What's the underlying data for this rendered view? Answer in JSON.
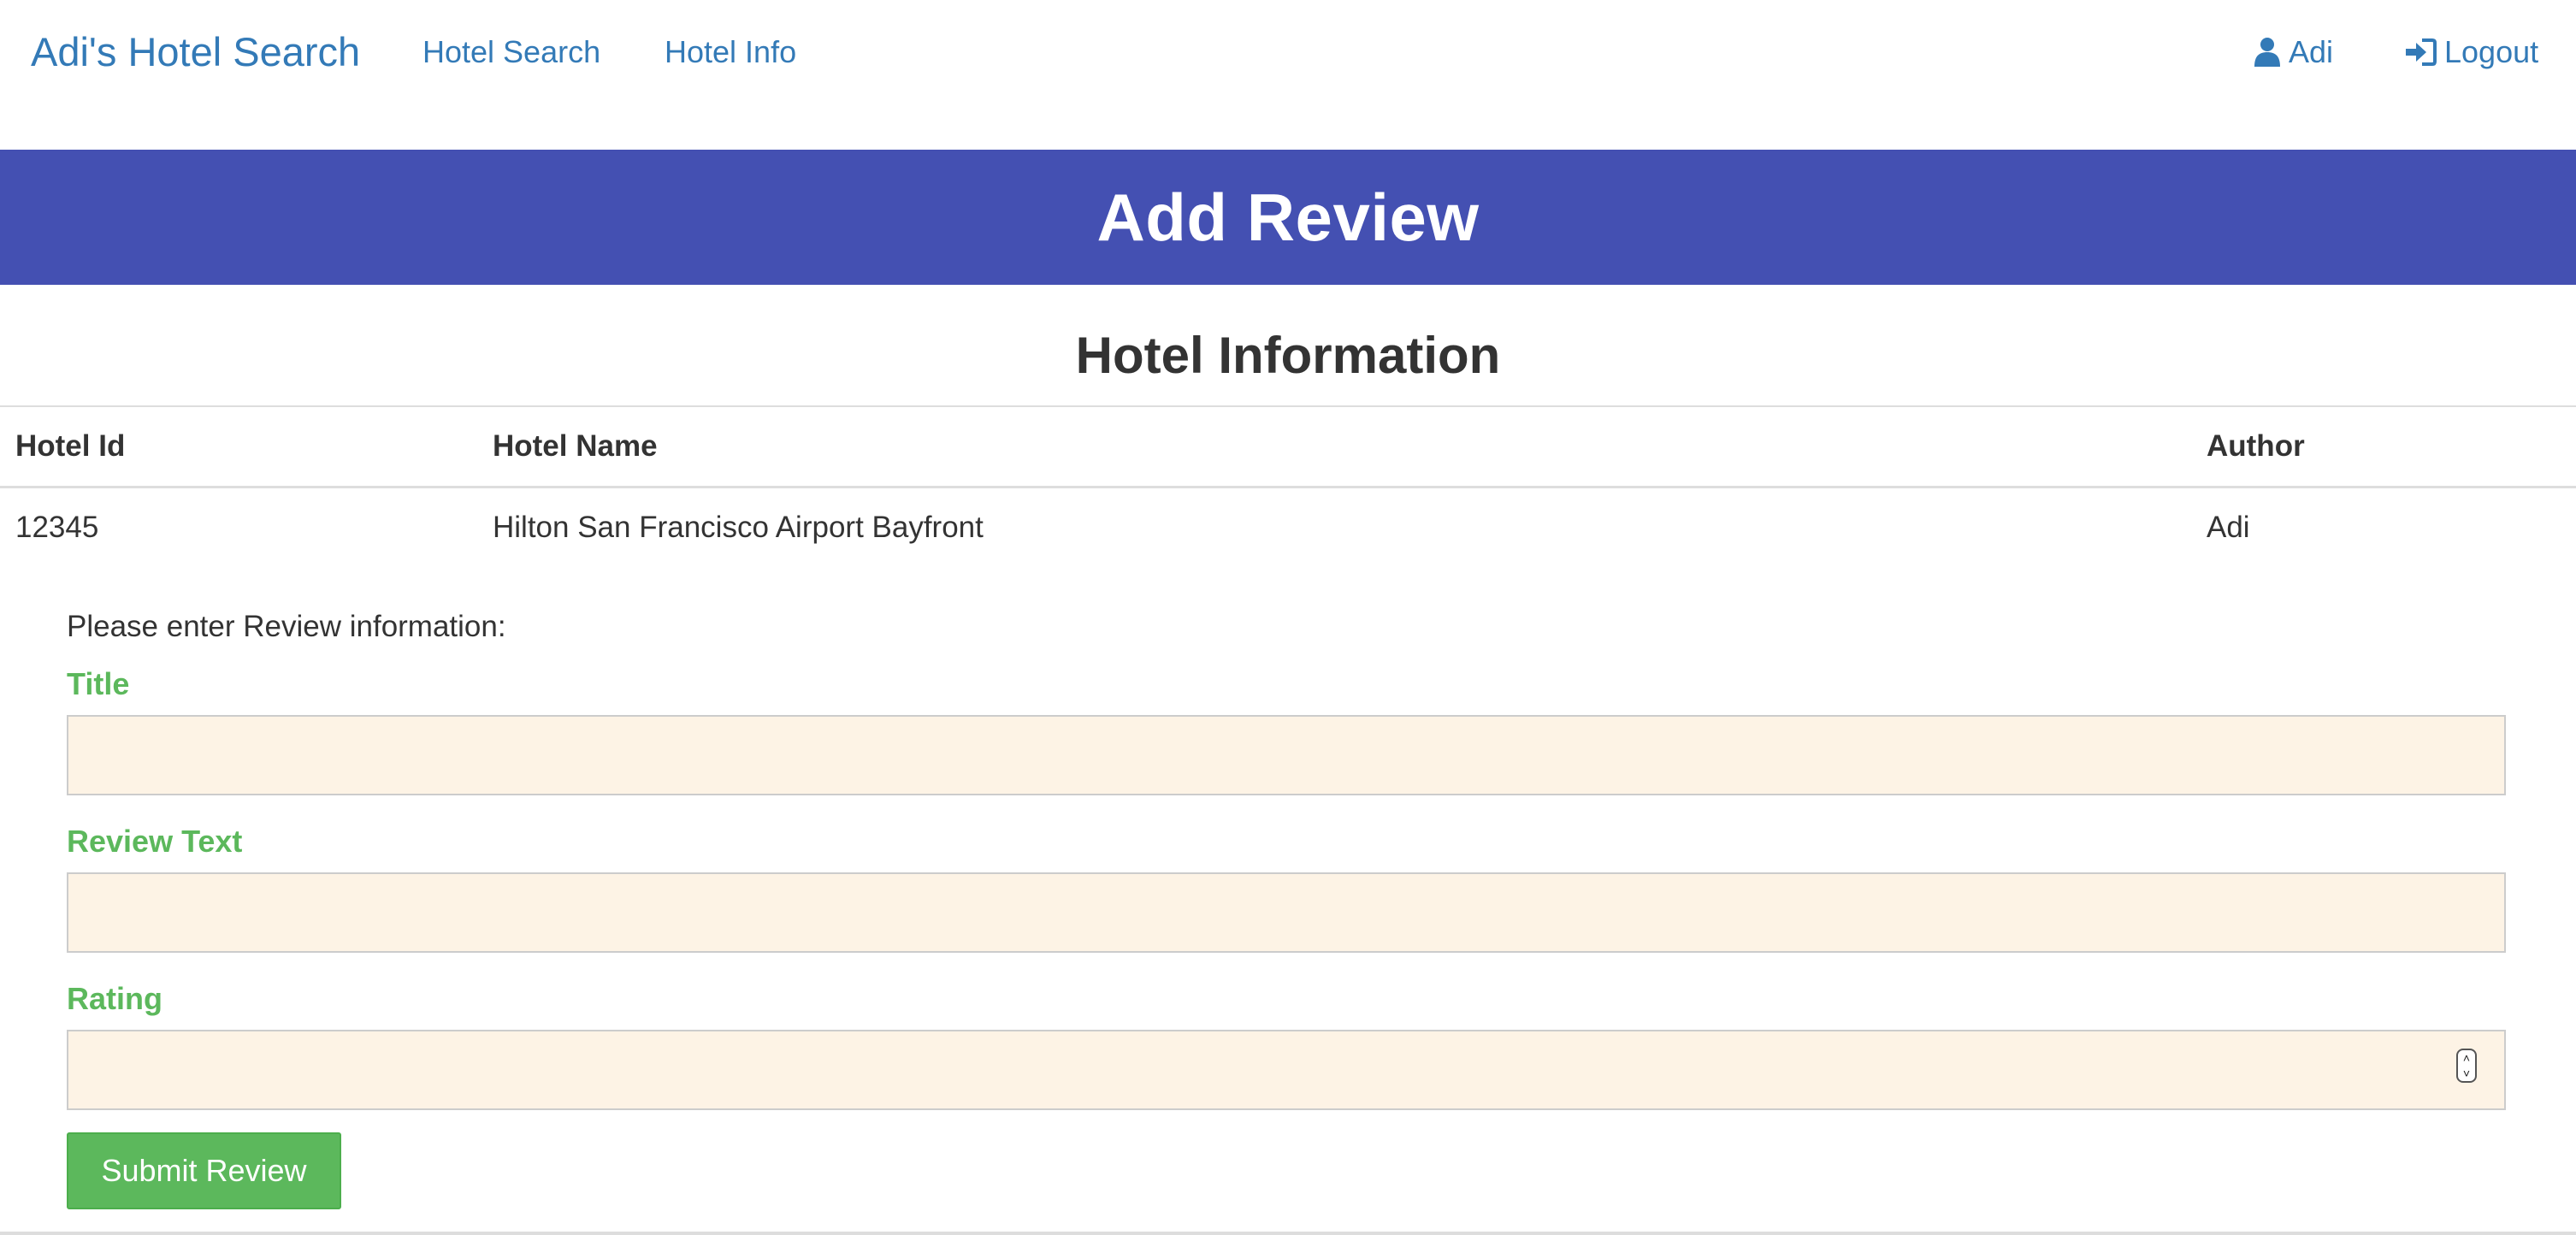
{
  "navbar": {
    "brand": "Adi's Hotel Search",
    "links": [
      {
        "label": "Hotel Search"
      },
      {
        "label": "Hotel Info"
      }
    ],
    "user_label": "Adi",
    "logout_label": "Logout",
    "link_color": "#337ab7"
  },
  "banner": {
    "title": "Add Review",
    "background": "#4450b2"
  },
  "hotel_info": {
    "title": "Hotel Information",
    "columns": [
      "Hotel Id",
      "Hotel Name",
      "Author"
    ],
    "rows": [
      [
        "12345",
        "Hilton San Francisco Airport Bayfront",
        "Adi"
      ]
    ]
  },
  "form": {
    "intro": "Please enter Review information:",
    "title_label": "Title",
    "title_value": "",
    "review_text_label": "Review Text",
    "review_text_value": "",
    "rating_label": "Rating",
    "rating_value": "",
    "submit_label": "Submit Review",
    "label_color": "#5cb85c",
    "input_background": "#fdf3e5"
  },
  "icons": {
    "user": "user-icon",
    "logout": "logout-icon",
    "spinner": "spinner-arrows-icon"
  }
}
